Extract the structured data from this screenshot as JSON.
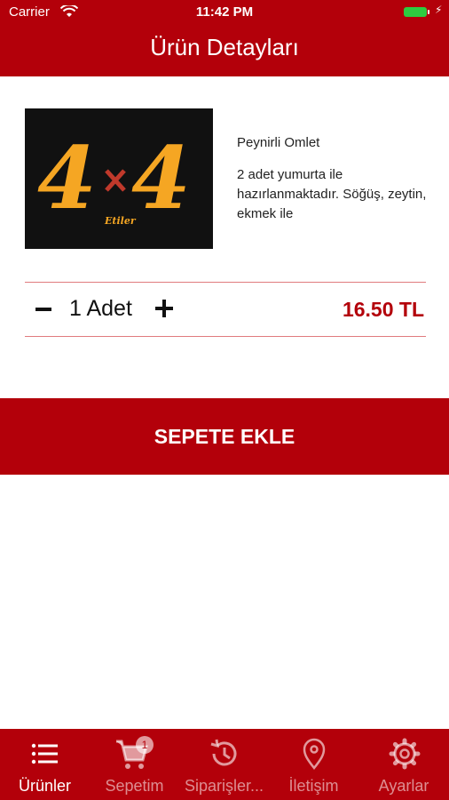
{
  "status_bar": {
    "carrier": "Carrier",
    "time": "11:42 PM"
  },
  "header": {
    "title": "Ürün Detayları"
  },
  "product": {
    "image_logo_text": "4×4 Etiler",
    "name": "Peynirli Omlet",
    "description": "2 adet yumurta ile hazırlanmaktadır. Söğüş, zeytin, ekmek ile"
  },
  "quantity": {
    "text": "1 Adet"
  },
  "price": {
    "text": "16.50 TL"
  },
  "add_to_cart": {
    "label": "SEPETE EKLE"
  },
  "tabbar": {
    "tabs": [
      {
        "label": "Ürünler",
        "icon": "list-icon",
        "active": true
      },
      {
        "label": "Sepetim",
        "icon": "cart-icon",
        "active": false,
        "badge": "1"
      },
      {
        "label": "Siparişler...",
        "icon": "history-icon",
        "active": false
      },
      {
        "label": "İletişim",
        "icon": "location-pin-icon",
        "active": false
      },
      {
        "label": "Ayarlar",
        "icon": "gear-icon",
        "active": false
      }
    ]
  },
  "colors": {
    "brand": "#b3000a",
    "logo_yellow": "#f5a623",
    "divider": "#e07b7e"
  }
}
